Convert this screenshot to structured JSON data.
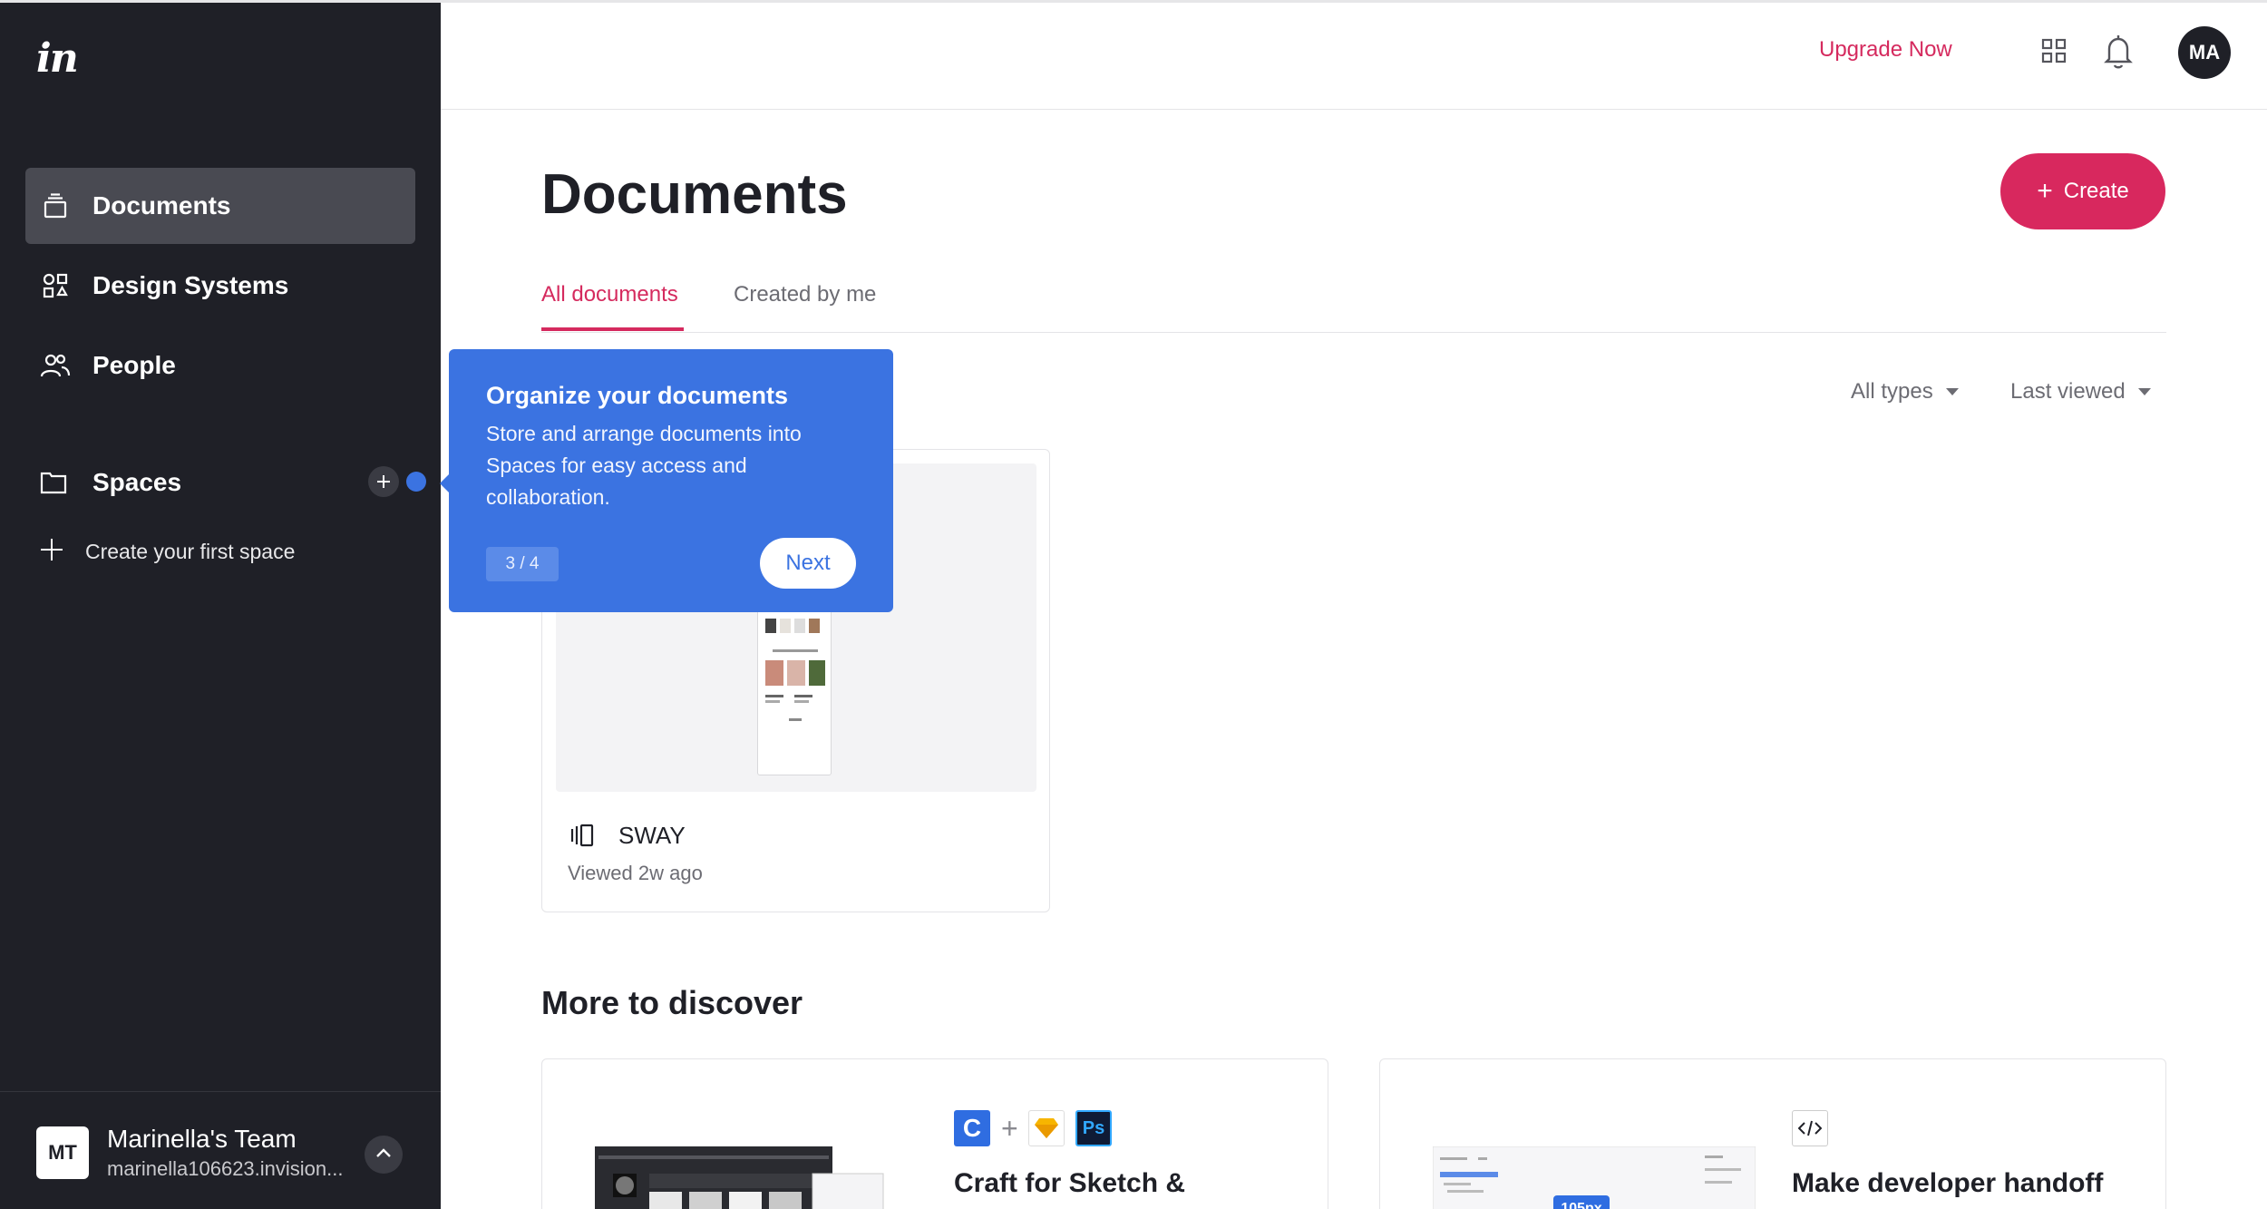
{
  "sidebar": {
    "logo": "in",
    "items": [
      {
        "label": "Documents",
        "icon": "documents-icon",
        "active": true
      },
      {
        "label": "Design Systems",
        "icon": "design-systems-icon",
        "active": false
      },
      {
        "label": "People",
        "icon": "people-icon",
        "active": false
      }
    ],
    "spaces": {
      "label": "Spaces",
      "create_label": "Create your first space"
    },
    "team": {
      "initials": "MT",
      "name": "Marinella's Team",
      "url": "marinella106623.invision..."
    }
  },
  "header": {
    "upgrade_label": "Upgrade Now",
    "avatar_initials": "MA"
  },
  "main": {
    "title": "Documents",
    "create_label": "Create",
    "tabs": [
      {
        "label": "All documents",
        "active": true
      },
      {
        "label": "Created by me",
        "active": false
      }
    ],
    "filters": {
      "type": "All types",
      "sort": "Last viewed"
    },
    "documents": [
      {
        "name": "SWAY",
        "meta": "Viewed 2w ago"
      }
    ],
    "discover": {
      "title": "More to discover",
      "cards": [
        {
          "title": "Craft for Sketch &"
        },
        {
          "title": "Make developer handoff",
          "badge": "105px"
        }
      ]
    }
  },
  "tooltip": {
    "title": "Organize your documents",
    "body": "Store and arrange documents into Spaces for easy access and collaboration.",
    "step": "3 / 4",
    "next_label": "Next"
  },
  "colors": {
    "sidebar_bg": "#1f2027",
    "accent": "#d52a5e",
    "tooltip_bg": "#3b73e1"
  }
}
